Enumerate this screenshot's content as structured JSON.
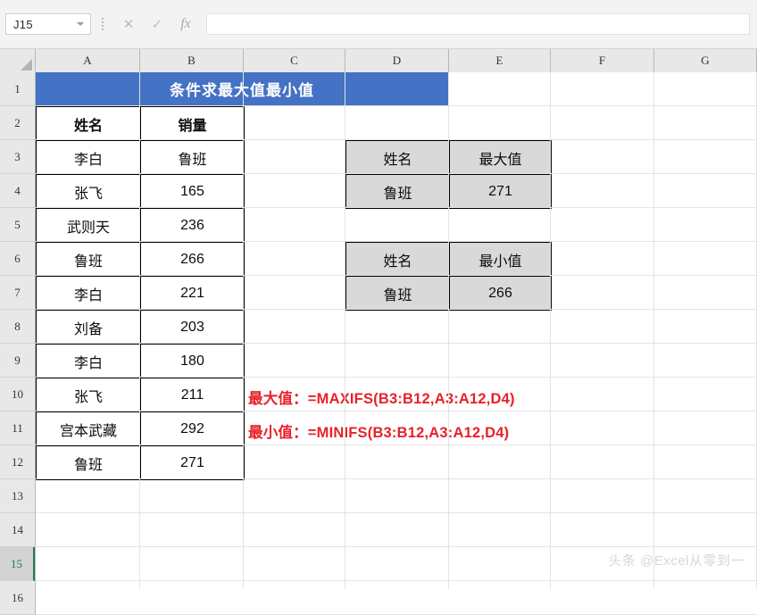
{
  "formula_bar": {
    "name_box_value": "J15",
    "cancel_icon": "✕",
    "confirm_icon": "✓",
    "function_icon": "fx",
    "formula_value": ""
  },
  "grid": {
    "column_headers": [
      "A",
      "B",
      "C",
      "D",
      "E",
      "F",
      "G"
    ],
    "selected_column": "",
    "row_headers": [
      "1",
      "2",
      "3",
      "4",
      "5",
      "6",
      "7",
      "8",
      "9",
      "10",
      "11",
      "12",
      "13",
      "14",
      "15",
      "16"
    ],
    "selected_row": "15"
  },
  "title_cell": {
    "text": "条件求最大值最小值",
    "range": "A1:D1",
    "fill_color": "#4472c4",
    "font_color": "#ffffff"
  },
  "data_table": {
    "range": "A2:B12",
    "headers": [
      "姓名",
      "销量"
    ],
    "rows": [
      {
        "name": "李白",
        "sales": "鲁班"
      },
      {
        "name": "张飞",
        "sales": "165"
      },
      {
        "name": "武则天",
        "sales": "236"
      },
      {
        "name": "鲁班",
        "sales": "266"
      },
      {
        "name": "李白",
        "sales": "221"
      },
      {
        "name": "刘备",
        "sales": "203"
      },
      {
        "name": "李白",
        "sales": "180"
      },
      {
        "name": "张飞",
        "sales": "211"
      },
      {
        "name": "宫本武藏",
        "sales": "292"
      },
      {
        "name": "鲁班",
        "sales": "271"
      }
    ]
  },
  "max_table": {
    "range": "D3:E4",
    "headers": [
      "姓名",
      "最大值"
    ],
    "values": [
      "鲁班",
      "271"
    ],
    "fill_color": "#d9d9d9"
  },
  "min_table": {
    "range": "D6:E7",
    "headers": [
      "姓名",
      "最小值"
    ],
    "values": [
      "鲁班",
      "266"
    ],
    "fill_color": "#d9d9d9"
  },
  "notes": {
    "max_note": "最大值：=MAXIFS(B3:B12,A3:A12,D4)",
    "min_note": "最小值：=MINIFS(B3:B12,A3:A12,D4)",
    "color": "#e8212a"
  },
  "watermark": {
    "text": "头条 @Excel从零到一"
  }
}
